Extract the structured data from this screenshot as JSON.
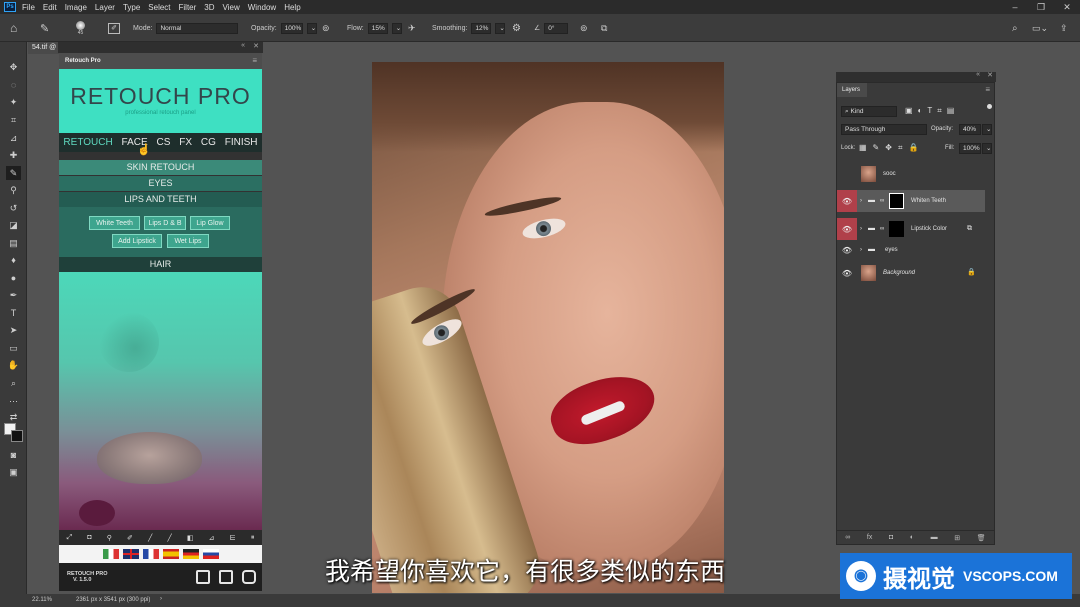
{
  "menubar": {
    "app_icon": "Ps",
    "items": [
      "File",
      "Edit",
      "Image",
      "Layer",
      "Type",
      "Select",
      "Filter",
      "3D",
      "View",
      "Window",
      "Help"
    ]
  },
  "options": {
    "brush_size": "45",
    "mode_label": "Mode:",
    "mode_value": "Normal",
    "opacity_label": "Opacity:",
    "opacity_value": "100%",
    "flow_label": "Flow:",
    "flow_value": "15%",
    "smoothing_label": "Smoothing:",
    "smoothing_value": "12%",
    "angle_value": "0°"
  },
  "document": {
    "tab_label": "54.tif @"
  },
  "retouch_panel": {
    "title": "Retouch Pro",
    "logo": "RETOUCH PRO",
    "logo_sub": "professional retouch panel",
    "tabs": [
      "RETOUCH",
      "FACE",
      "CS",
      "FX",
      "CG",
      "FINISH"
    ],
    "active_tab": "FACE",
    "sections": [
      "SKIN RETOUCH",
      "EYES",
      "LIPS AND TEETH",
      "HAIR"
    ],
    "buttons": [
      "White Teeth",
      "Lips D & B",
      "Lip Glow",
      "Add Lipstick",
      "Wet Lips"
    ],
    "version_line1": "RETOUCH PRO",
    "version_line2": "V. 1.5.0"
  },
  "layers_panel": {
    "tab": "Layers",
    "kind_label": "Kind",
    "blend_mode": "Pass Through",
    "opacity_label": "Opacity:",
    "opacity_value": "40%",
    "lock_label": "Lock:",
    "fill_label": "Fill:",
    "fill_value": "100%",
    "layers": [
      {
        "name": "sooc",
        "visible": false,
        "selected": false
      },
      {
        "name": "Whiten Teeth",
        "visible": true,
        "selected": true
      },
      {
        "name": "Lipstick Color",
        "visible": true,
        "selected": false
      },
      {
        "name": "eyes",
        "visible": true,
        "selected": false
      },
      {
        "name": "Background",
        "visible": true,
        "selected": false
      }
    ]
  },
  "status": {
    "zoom": "22.11%",
    "doc_info": "2361 px x 3541 px (300 ppi)"
  },
  "subtitle": "我希望你喜欢它，有很多类似的东西",
  "watermark": {
    "cn": "摄视觉",
    "en": "VSCOPS.COM"
  }
}
